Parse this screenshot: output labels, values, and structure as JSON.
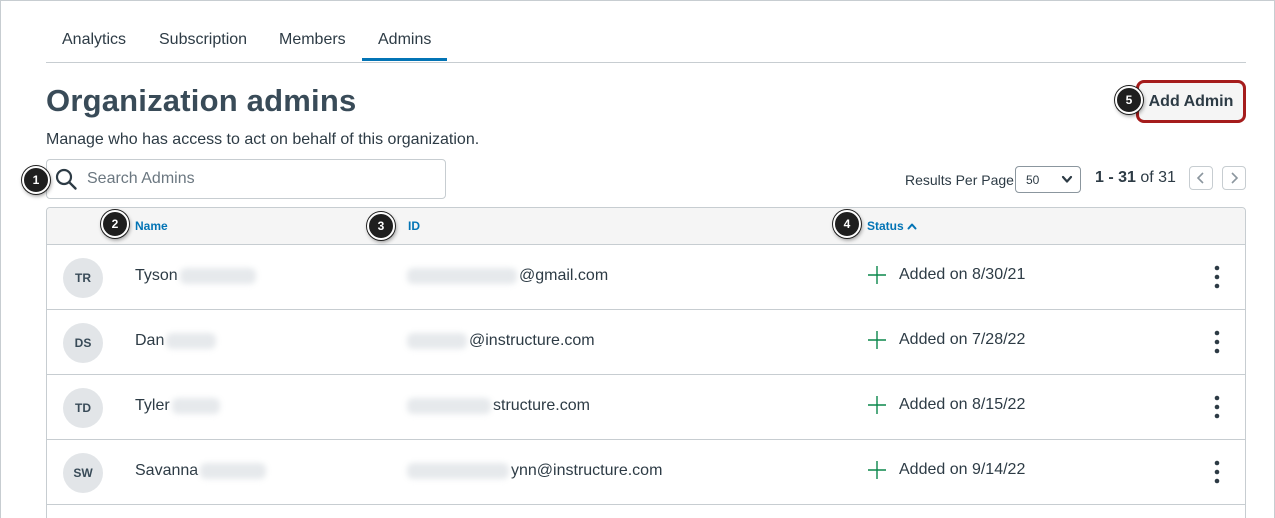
{
  "tabs": [
    {
      "label": "Analytics",
      "active": false
    },
    {
      "label": "Subscription",
      "active": false
    },
    {
      "label": "Members",
      "active": false
    },
    {
      "label": "Admins",
      "active": true
    }
  ],
  "page": {
    "title": "Organization admins",
    "subtitle": "Manage who has access to act on behalf of this organization.",
    "add_admin_label": "Add Admin"
  },
  "search": {
    "placeholder": "Search Admins",
    "value": ""
  },
  "pagination": {
    "results_per_page_label": "Results Per Page",
    "results_per_page_value": "50",
    "range_bold": "1 - 31",
    "range_rest": " of 31"
  },
  "table": {
    "headers": {
      "name": "Name",
      "id": "ID",
      "status": "Status"
    },
    "rows": [
      {
        "initials": "TR",
        "name": "Tyson",
        "id": "@gmail.com",
        "status": "Added on 8/30/21"
      },
      {
        "initials": "DS",
        "name": "Dan",
        "id": "@instructure.com",
        "status": "Added on 7/28/22"
      },
      {
        "initials": "TD",
        "name": "Tyler",
        "id": "structure.com",
        "status": "Added on 8/15/22"
      },
      {
        "initials": "SW",
        "name": "Savanna",
        "id": "ynn@instructure.com",
        "status": "Added on 9/14/22"
      }
    ]
  },
  "callouts": [
    "1",
    "2",
    "3",
    "4",
    "5"
  ],
  "colors": {
    "accent": "#0374b5",
    "highlight_border": "#a51c1c",
    "status_green": "#0b874b"
  },
  "icons": {
    "search": "search-icon",
    "sort": "chevron-up-icon",
    "status": "plus-icon",
    "menu": "kebab-icon"
  }
}
